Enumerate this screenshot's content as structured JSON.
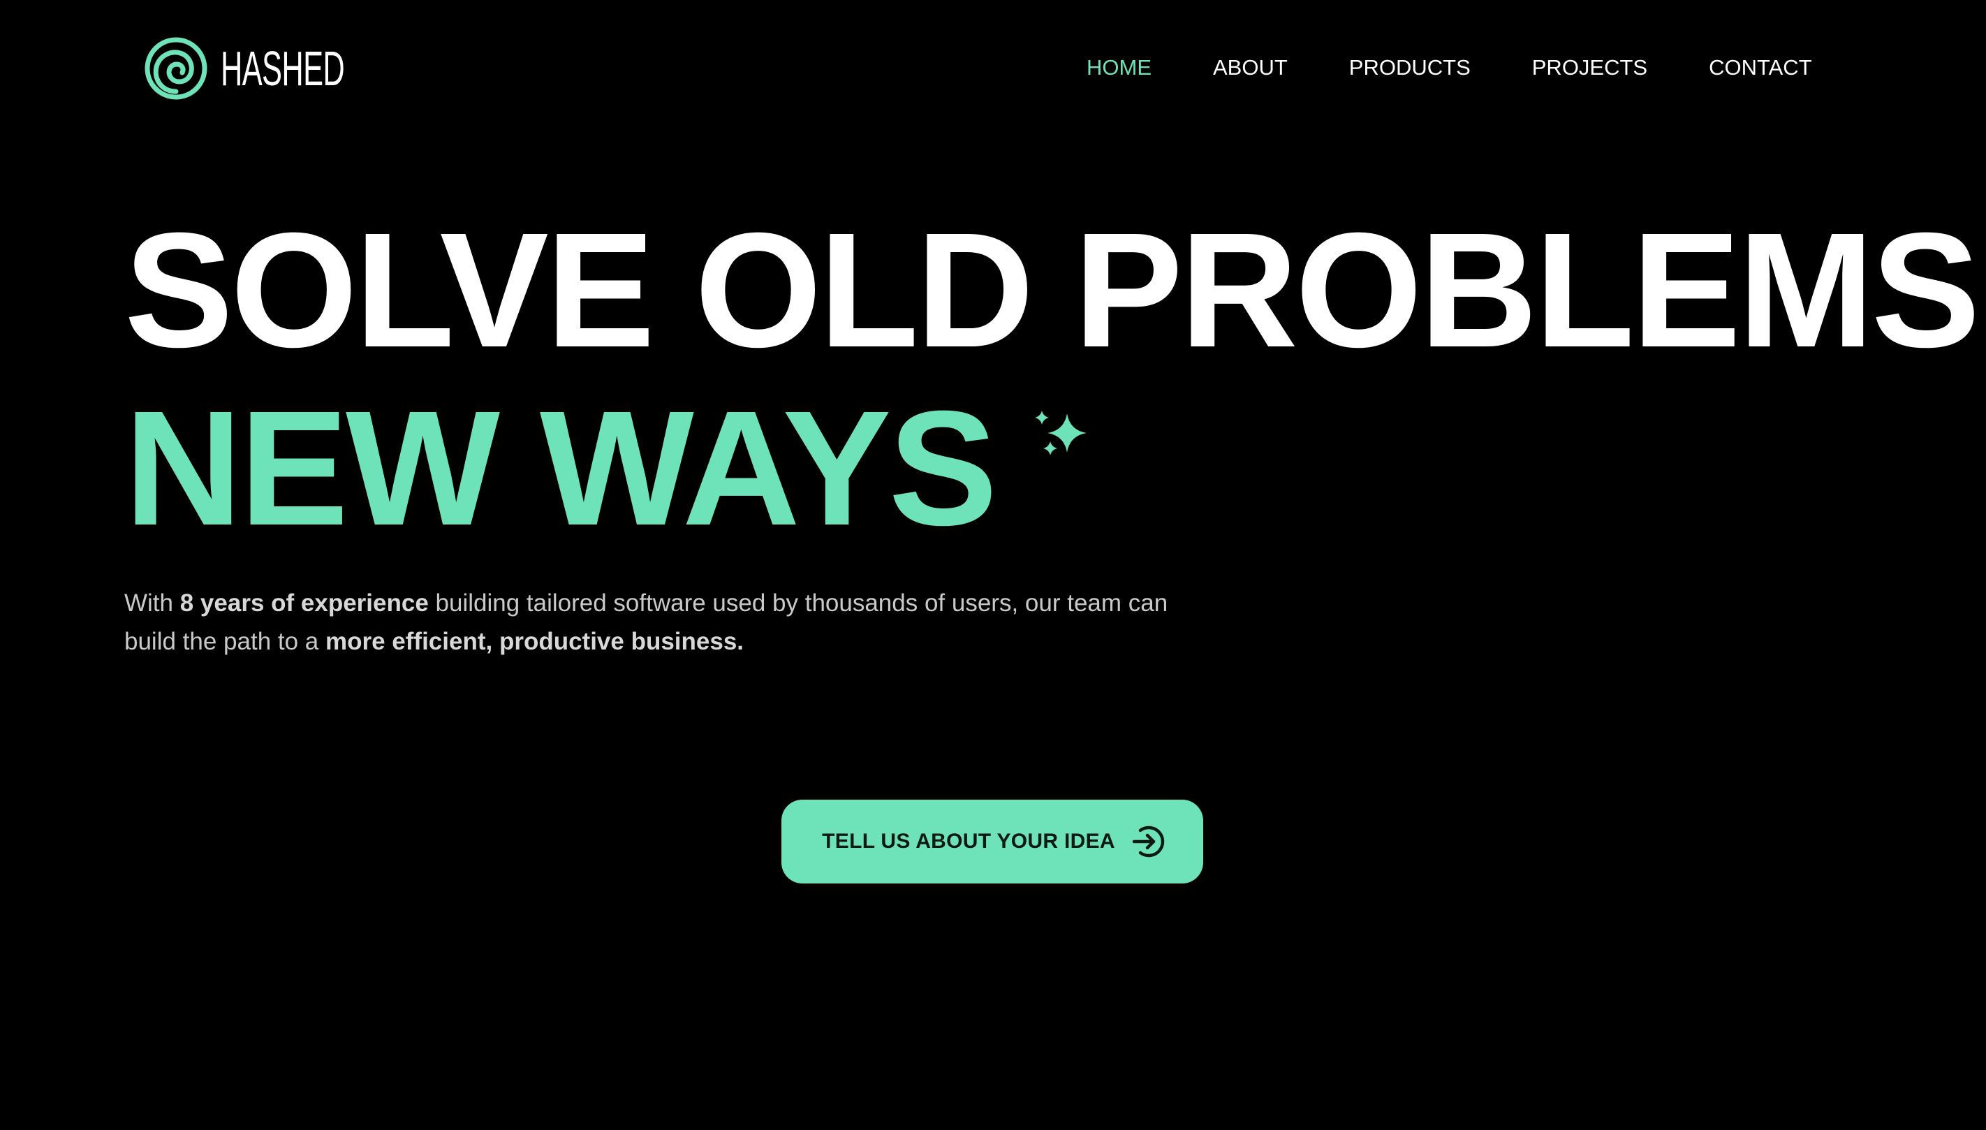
{
  "colors": {
    "background": "#000000",
    "accent": "#6ee2b9",
    "text": "#ffffff",
    "muted_text": "#c9c9c9"
  },
  "header": {
    "logo": {
      "icon": "spiral-logo-icon",
      "text": "HASHED"
    },
    "nav": {
      "items": [
        {
          "label": "HOME",
          "active": true
        },
        {
          "label": "ABOUT",
          "active": false
        },
        {
          "label": "PRODUCTS",
          "active": false
        },
        {
          "label": "PROJECTS",
          "active": false
        },
        {
          "label": "CONTACT",
          "active": false
        }
      ]
    }
  },
  "hero": {
    "headline_line1": "SOLVE OLD PROBLEMS",
    "headline_line2": "NEW WAYS",
    "decoration_icon": "sparkle-icon",
    "lead": {
      "part1": "With ",
      "bold1": "8 years of experience",
      "part2": " building tailored software used by thousands of users, our team can build the path to a ",
      "bold2": "more efficient, productive business."
    },
    "cta": {
      "label": "TELL US ABOUT YOUR IDEA",
      "icon": "arrow-right-circle-icon"
    }
  }
}
